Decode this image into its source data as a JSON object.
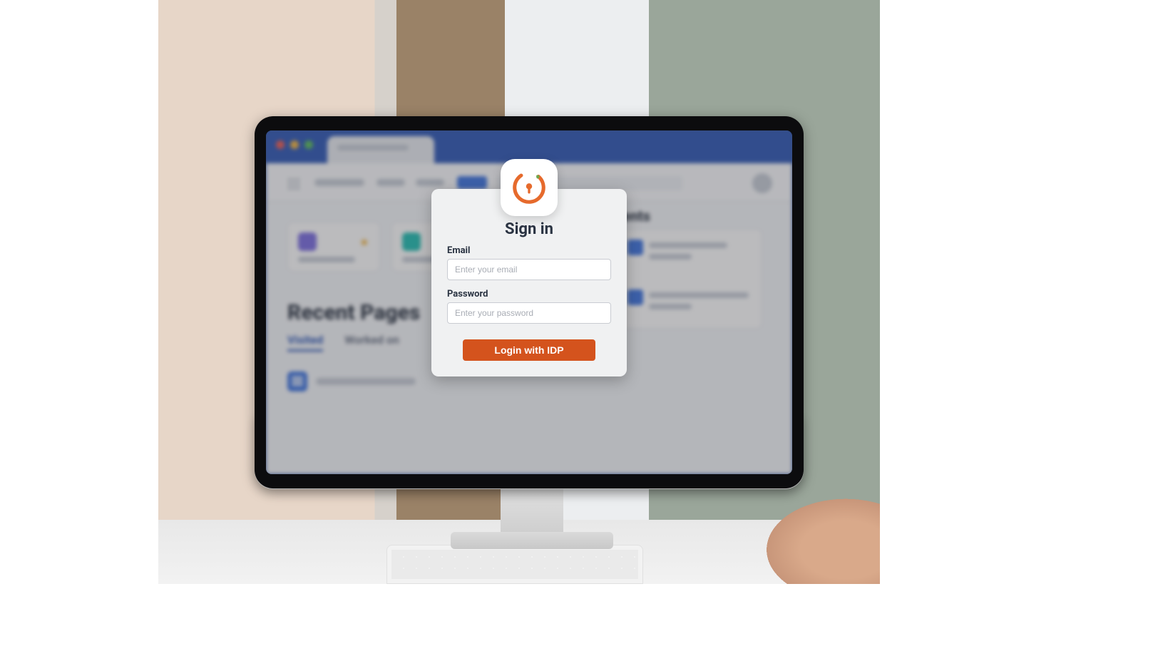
{
  "background_app": {
    "recent_pages_heading": "Recent Pages",
    "tabs": {
      "visited": "Visited",
      "worked_on": "Worked on"
    },
    "right_heading_partial": "ncements"
  },
  "signin": {
    "title": "Sign in",
    "email_label": "Email",
    "email_placeholder": "Enter your email",
    "password_label": "Password",
    "password_placeholder": "Enter your password",
    "login_button": "Login with IDP"
  },
  "colors": {
    "accent": "#d4531d",
    "brand_orange": "#e66a2c",
    "link_blue": "#2d57b6"
  }
}
